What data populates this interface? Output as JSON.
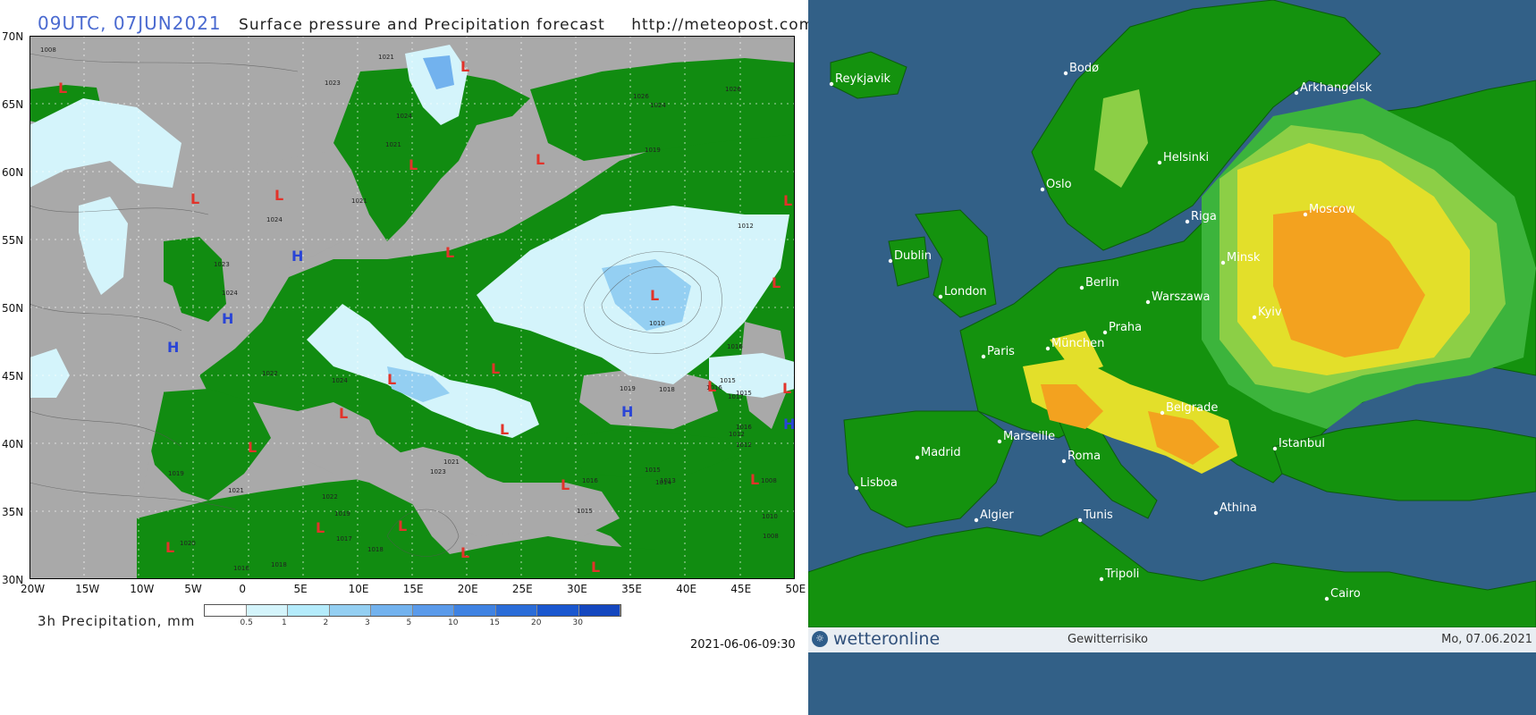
{
  "left": {
    "title_time": "09UTC, 07JUN2021",
    "title_desc": "Surface pressure and Precipitation forecast",
    "title_url": "http://meteopost.com",
    "lat_labels": [
      "70N",
      "65N",
      "60N",
      "55N",
      "50N",
      "45N",
      "40N",
      "35N",
      "30N"
    ],
    "lon_labels": [
      "20W",
      "15W",
      "10W",
      "5W",
      "0",
      "5E",
      "10E",
      "15E",
      "20E",
      "25E",
      "30E",
      "35E",
      "40E",
      "45E",
      "50E"
    ],
    "legend_title": "3h Precipitation, mm",
    "legend_values": [
      "0.5",
      "1",
      "2",
      "3",
      "5",
      "10",
      "15",
      "20",
      "30"
    ],
    "legend_colors": [
      "#ffffff",
      "#d4f4fb",
      "#b4ebfb",
      "#94cff2",
      "#72b2ee",
      "#5a9aea",
      "#3f82e2",
      "#2a6cd8",
      "#1a57cf",
      "#1447bf"
    ],
    "timestamp": "2021-06-06-09:30",
    "pressure_labels": [
      "1008",
      "1021",
      "1023",
      "1024",
      "1026",
      "1026",
      "1024",
      "1021",
      "1021",
      "1024",
      "1023",
      "1024",
      "1022",
      "1024",
      "1021",
      "1023",
      "1019",
      "1018",
      "1016",
      "1015",
      "1016",
      "1012",
      "1010",
      "1015",
      "1016",
      "1017",
      "1012",
      "1008",
      "1010",
      "1008",
      "1022",
      "1019",
      "1017",
      "1018",
      "1015",
      "1016",
      "1021",
      "1019",
      "1020",
      "1016",
      "1018",
      "1015",
      "1014",
      "1012",
      "1019",
      "1013"
    ],
    "highs": [
      "H",
      "H",
      "H",
      "H",
      "H"
    ],
    "lows": [
      "L",
      "L",
      "L",
      "L",
      "L",
      "L",
      "L",
      "L",
      "L",
      "L",
      "L",
      "L",
      "L",
      "L",
      "L",
      "L",
      "L",
      "L",
      "L",
      "L",
      "L",
      "L",
      "L",
      "L"
    ],
    "colors": {
      "land": "#118c11",
      "sea": "#a9a9a9",
      "high": "#2a45d6",
      "low": "#e2332a",
      "grid": "#ffffff"
    }
  },
  "right": {
    "cities": [
      "Reykjavik",
      "Bodø",
      "Arkhangelsk",
      "Helsinki",
      "Oslo",
      "Riga",
      "Moscow",
      "Dublin",
      "Minsk",
      "London",
      "Berlin",
      "Warszawa",
      "Kyiv",
      "Paris",
      "Praha",
      "München",
      "Belgrade",
      "Marseille",
      "Madrid",
      "Roma",
      "Istanbul",
      "Lisboa",
      "Athina",
      "Algier",
      "Tunis",
      "Tripoli",
      "Cairo"
    ],
    "footer_brand": "wetteronline",
    "footer_title": "Gewitterrisiko",
    "footer_date": "Mo, 07.06.2021",
    "colors": {
      "sea": "#326087",
      "green_dark": "#14920e",
      "green_mid": "#3cb43c",
      "green_light": "#8ccf46",
      "yellow": "#e3df2a",
      "orange": "#f3a21f"
    }
  }
}
